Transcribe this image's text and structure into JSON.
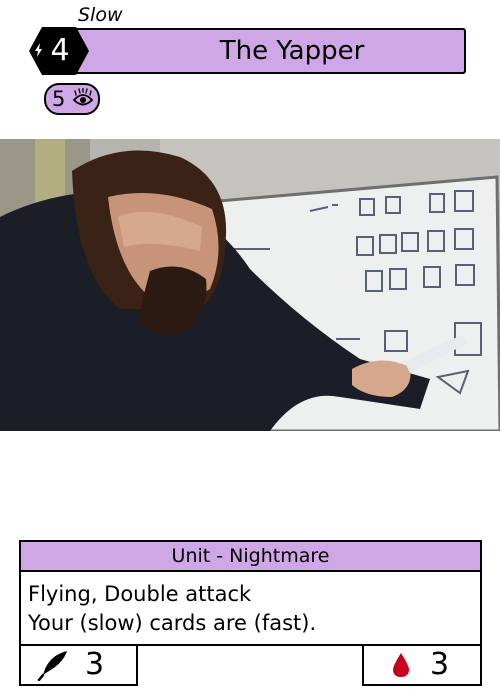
{
  "card": {
    "speed": "Slow",
    "cost": "4",
    "name": "The Yapper",
    "requirement": {
      "value": "5",
      "icon": "nightmare-eye-icon"
    },
    "type_line": "Unit - Nightmare",
    "rules": [
      "Flying, Double attack",
      "Your (slow) cards are (fast)."
    ],
    "power": {
      "value": "3",
      "icon": "quill-icon"
    },
    "health": {
      "value": "3",
      "icon": "blood-drop-icon"
    }
  },
  "colors": {
    "accent": "#cfa6e6",
    "border": "#000000",
    "blood": "#c8001e"
  }
}
